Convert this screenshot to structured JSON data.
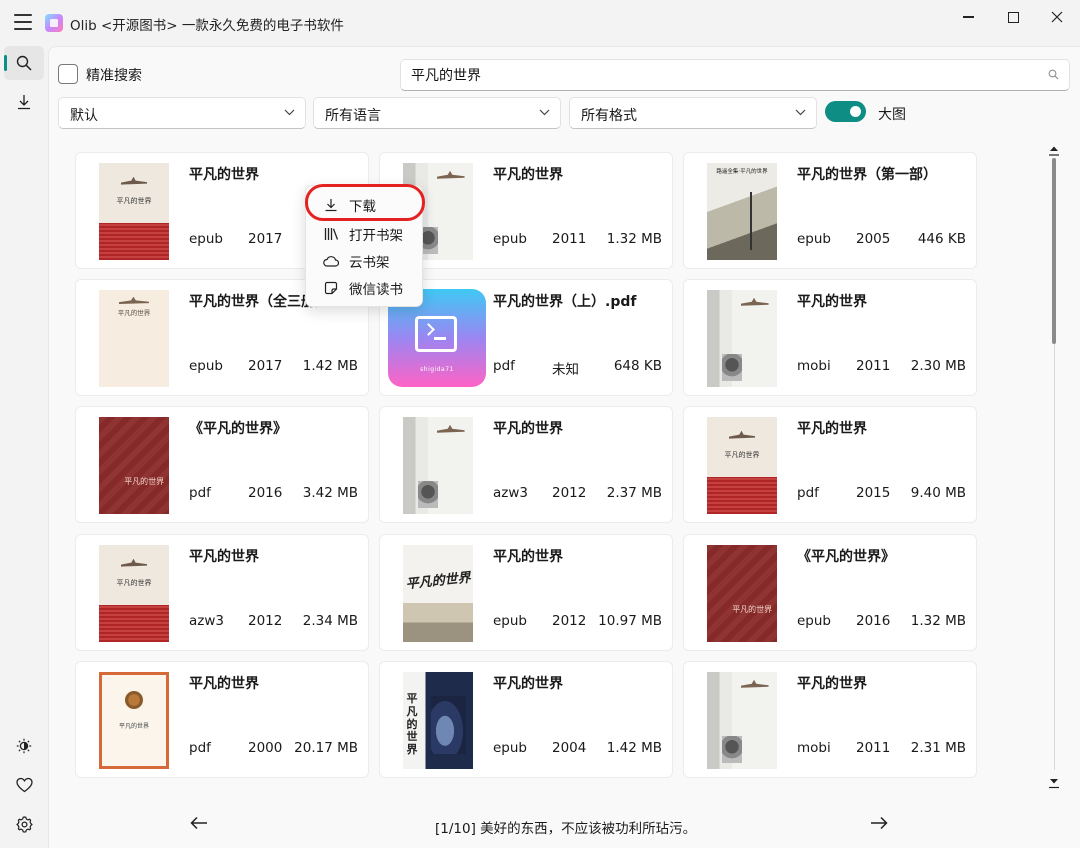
{
  "window": {
    "title": "Olib <开源图书> 一款永久免费的电子书软件",
    "controls": [
      "minimize",
      "maximize",
      "close"
    ]
  },
  "sidebar": {
    "top": [
      {
        "id": "search",
        "icon": "search-icon",
        "active": true
      },
      {
        "id": "download",
        "icon": "download-icon",
        "active": false
      }
    ],
    "bottom": [
      {
        "id": "theme",
        "icon": "theme-toggle-icon"
      },
      {
        "id": "favorites",
        "icon": "heart-icon"
      },
      {
        "id": "settings",
        "icon": "gear-icon"
      }
    ]
  },
  "search": {
    "exact_label": "精准搜索",
    "exact_checked": false,
    "query": "平凡的世界"
  },
  "filters": {
    "sort": "默认",
    "language": "所有语言",
    "format": "所有格式",
    "large_view_label": "大图",
    "large_view_on": true
  },
  "books": [
    {
      "title": "平凡的世界",
      "format": "epub",
      "year": "2017",
      "size": "",
      "cover": "red-top"
    },
    {
      "title": "平凡的世界",
      "format": "epub",
      "year": "2011",
      "size": "1.32 MB",
      "cover": "box"
    },
    {
      "title": "平凡的世界（第一部）",
      "format": "epub",
      "year": "2005",
      "size": "446 KB",
      "cover": "sketch"
    },
    {
      "title": "平凡的世界（全三册）",
      "format": "epub",
      "year": "2017",
      "size": "1.42 MB",
      "cover": "cream"
    },
    {
      "title": "平凡的世界（上）.pdf",
      "format": "pdf",
      "year": "未知",
      "size": "648 KB",
      "cover": "app"
    },
    {
      "title": "平凡的世界",
      "format": "mobi",
      "year": "2011",
      "size": "2.30 MB",
      "cover": "box"
    },
    {
      "title": "《平凡的世界》",
      "format": "pdf",
      "year": "2016",
      "size": "3.42 MB",
      "cover": "maroon"
    },
    {
      "title": "平凡的世界",
      "format": "azw3",
      "year": "2012",
      "size": "2.37 MB",
      "cover": "box"
    },
    {
      "title": "平凡的世界",
      "format": "pdf",
      "year": "2015",
      "size": "9.40 MB",
      "cover": "red-top"
    },
    {
      "title": "平凡的世界",
      "format": "azw3",
      "year": "2012",
      "size": "2.34 MB",
      "cover": "red-top"
    },
    {
      "title": "平凡的世界",
      "format": "epub",
      "year": "2012",
      "size": "10.97 MB",
      "cover": "brush"
    },
    {
      "title": "《平凡的世界》",
      "format": "epub",
      "year": "2016",
      "size": "1.32 MB",
      "cover": "maroon"
    },
    {
      "title": "平凡的世界",
      "format": "pdf",
      "year": "2000",
      "size": "20.17 MB",
      "cover": "vintage"
    },
    {
      "title": "平凡的世界",
      "format": "epub",
      "year": "2004",
      "size": "1.42 MB",
      "cover": "blue"
    },
    {
      "title": "平凡的世界",
      "format": "mobi",
      "year": "2011",
      "size": "2.31 MB",
      "cover": "box"
    }
  ],
  "cover_text": {
    "red_top": "平凡的世界",
    "cream": "平凡的世界",
    "sketch": "路遥全集·平凡的世界",
    "maroon": "平凡的世界",
    "brush": "平凡的世界",
    "vintage": "平凡的世界",
    "blue": "平凡的世界",
    "app_caption": "shigida71"
  },
  "context_menu": {
    "items": [
      {
        "label": "下载",
        "icon": "download-icon",
        "highlighted": true
      },
      {
        "label": "打开书架",
        "icon": "bookshelf-icon"
      },
      {
        "label": "云书架",
        "icon": "cloud-icon"
      },
      {
        "label": "微信读书",
        "icon": "note-icon"
      }
    ]
  },
  "footer": {
    "quote": "[1/10] 美好的东西，不应该被功利所玷污。"
  }
}
